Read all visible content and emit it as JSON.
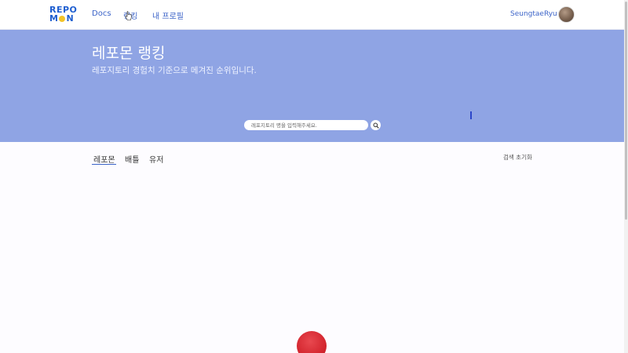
{
  "header": {
    "logo": {
      "line1": "REPO",
      "line2_left": "M",
      "line2_right": "N"
    },
    "nav": [
      "Docs",
      "랭킹",
      "내 프로필"
    ],
    "user_name": "SeungtaeRyu"
  },
  "hero": {
    "title": "레포몬 랭킹",
    "subtitle": "레포지토리 경험치 기준으로 메겨진 순위입니다.",
    "search_placeholder": "레포지토리 명을 입력해주세요."
  },
  "tabs": [
    "레포몬",
    "배틀",
    "유저"
  ],
  "reset_label": "검색 초기화",
  "colors": {
    "accent": "#3c64c8",
    "hero_bg": "#8fa4e4",
    "logo_blue": "#1f5fd0",
    "logo_yellow": "#f3c428",
    "ball_red": "#d4262f"
  }
}
